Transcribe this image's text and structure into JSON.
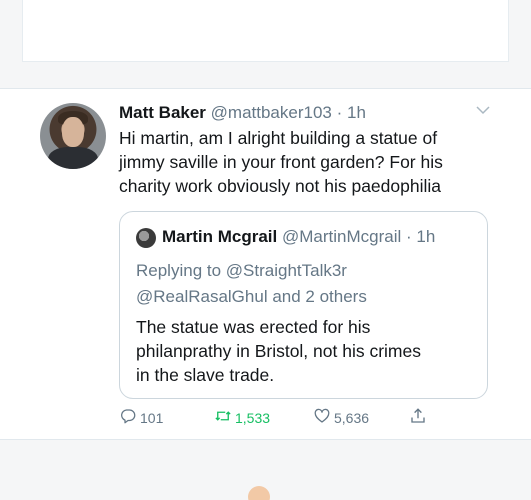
{
  "tweet": {
    "author": {
      "name": "Matt Baker",
      "handle": "@mattbaker103",
      "separator": " · ",
      "time": "1h"
    },
    "text_lines": [
      "Hi martin, am I alright building a statue of",
      "jimmy saville in your front garden? For his",
      "charity work obviously not his paedophilia"
    ],
    "quote": {
      "name": "Martin Mcgrail",
      "handle": "@MartinMcgrail",
      "separator": " · ",
      "time": "1h",
      "reply_lines": [
        "Replying to @StraightTalk3r",
        "@RealRasalGhul and 2 others"
      ],
      "text_lines": [
        "The statue was erected for his",
        "philanprathy in Bristol, not his crimes",
        "in the slave trade."
      ]
    },
    "actions": {
      "replies": "101",
      "retweets": "1,533",
      "likes": "5,636"
    }
  },
  "icons": {
    "reply": "reply-icon",
    "retweet": "retweet-icon",
    "like": "heart-icon",
    "share": "share-icon",
    "menu": "chevron-down-icon"
  },
  "colors": {
    "text": "#14171a",
    "muted": "#657786",
    "retweet_green": "#17bf63",
    "border": "#ccd6dd"
  }
}
